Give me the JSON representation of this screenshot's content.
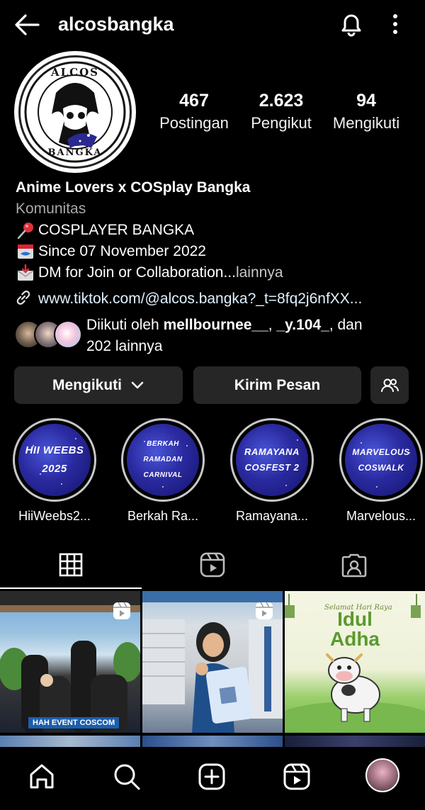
{
  "header": {
    "username": "alcosbangka"
  },
  "profile": {
    "avatar_text_top": "ALCOS",
    "avatar_text_bottom": "BANGKA",
    "stats": [
      {
        "value": "467",
        "label": "Postingan"
      },
      {
        "value": "2.623",
        "label": "Pengikut"
      },
      {
        "value": "94",
        "label": "Mengikuti"
      }
    ],
    "display_name": "Anime Lovers x COSplay Bangka",
    "category": "Komunitas",
    "bio_lines": [
      {
        "icon": "pushpin-icon",
        "text": "COSPLAYER BANGKA"
      },
      {
        "icon": "calendar-icon",
        "text": " Since 07 November 2022"
      },
      {
        "icon": "inbox-icon",
        "text": "DM for Join or Collaboration..."
      }
    ],
    "more_label": " lainnya",
    "link": "www.tiktok.com/@alcos.bangka?_t=8fq2j6nfXX...",
    "followed_by_prefix": "Diikuti oleh ",
    "followed_by_user1": "mellbournee__",
    "followed_by_sep": ", ",
    "followed_by_user2": "_y.104_",
    "followed_by_suffix": ", dan",
    "followed_by_more": "202 lainnya"
  },
  "actions": {
    "following_label": "Mengikuti",
    "message_label": "Kirim Pesan"
  },
  "highlights": [
    {
      "art_line1": "HII WEEBS",
      "art_line2": "2025",
      "caption": "HiiWeebs2..."
    },
    {
      "art_line1": "BERKAH RAMADAN",
      "art_line2": "CARNIVAL",
      "caption": "Berkah Ra..."
    },
    {
      "art_line1": "RAMAYANA",
      "art_line2": "COSFEST 2",
      "caption": "Ramayana..."
    },
    {
      "art_line1": "MARVELOUS",
      "art_line2": "COSWALK",
      "caption": "Marvelous..."
    }
  ],
  "grid": {
    "post1_caption": "HAH EVENT COSCOM",
    "post3_script": "Selamat Hari Raya",
    "post3_title1": "Idul",
    "post3_title2": "Adha"
  },
  "colors": {
    "background": "#000000",
    "button": "#262626",
    "secondary_text": "#a8a8a8",
    "link": "#e0f1ff"
  }
}
